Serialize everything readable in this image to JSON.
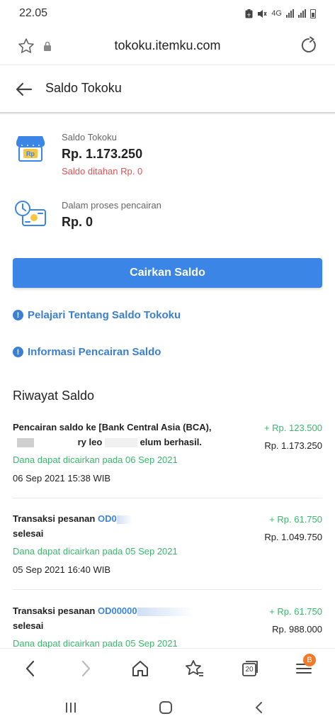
{
  "status_bar": {
    "time": "22.05",
    "network": "4G"
  },
  "browser": {
    "url": "tokoku.itemku.com"
  },
  "header": {
    "title": "Saldo Tokoku"
  },
  "balance": {
    "label": "Saldo Tokoku",
    "value": "Rp. 1.173.250",
    "hold": "Saldo ditahan Rp. 0",
    "icon_text": "Rp"
  },
  "withdraw_process": {
    "label": "Dalam proses pencairan",
    "value": "Rp. 0"
  },
  "withdraw_button": "Cairkan Saldo",
  "links": {
    "learn": "Pelajari Tentang Saldo Tokoku",
    "info": "Informasi Pencairan Saldo"
  },
  "history": {
    "title": "Riwayat Saldo",
    "items": [
      {
        "line1": "Pencairan saldo ke [Bank Central Asia (BCA),",
        "line2": "ry leo",
        "line2_end": "elum berhasil.",
        "amount": "+ Rp. 123.500",
        "balance": "Rp. 1.173.250",
        "note": "Dana dapat dicairkan pada 06 Sep 2021",
        "date": "06 Sep 2021 15:38 WIB"
      },
      {
        "prefix": "Transaksi pesanan",
        "order_id": "OD0",
        "line2": "selesai",
        "amount": "+ Rp. 61.750",
        "balance": "Rp. 1.049.750",
        "note": "Dana dapat dicairkan pada 05 Sep 2021",
        "date": "05 Sep 2021 16:40 WIB"
      },
      {
        "prefix": "Transaksi pesanan",
        "order_id": "OD00000",
        "line2": "selesai",
        "amount": "+ Rp. 61.750",
        "balance": "Rp. 988.000",
        "note": "Dana dapat dicairkan pada 05 Sep 2021"
      }
    ]
  },
  "bottom_nav": {
    "tabs_count": "20",
    "badge": "B"
  },
  "colors": {
    "primary": "#3b85e6",
    "link": "#3b7fd2",
    "positive": "#39b86b",
    "danger": "#e05050"
  }
}
